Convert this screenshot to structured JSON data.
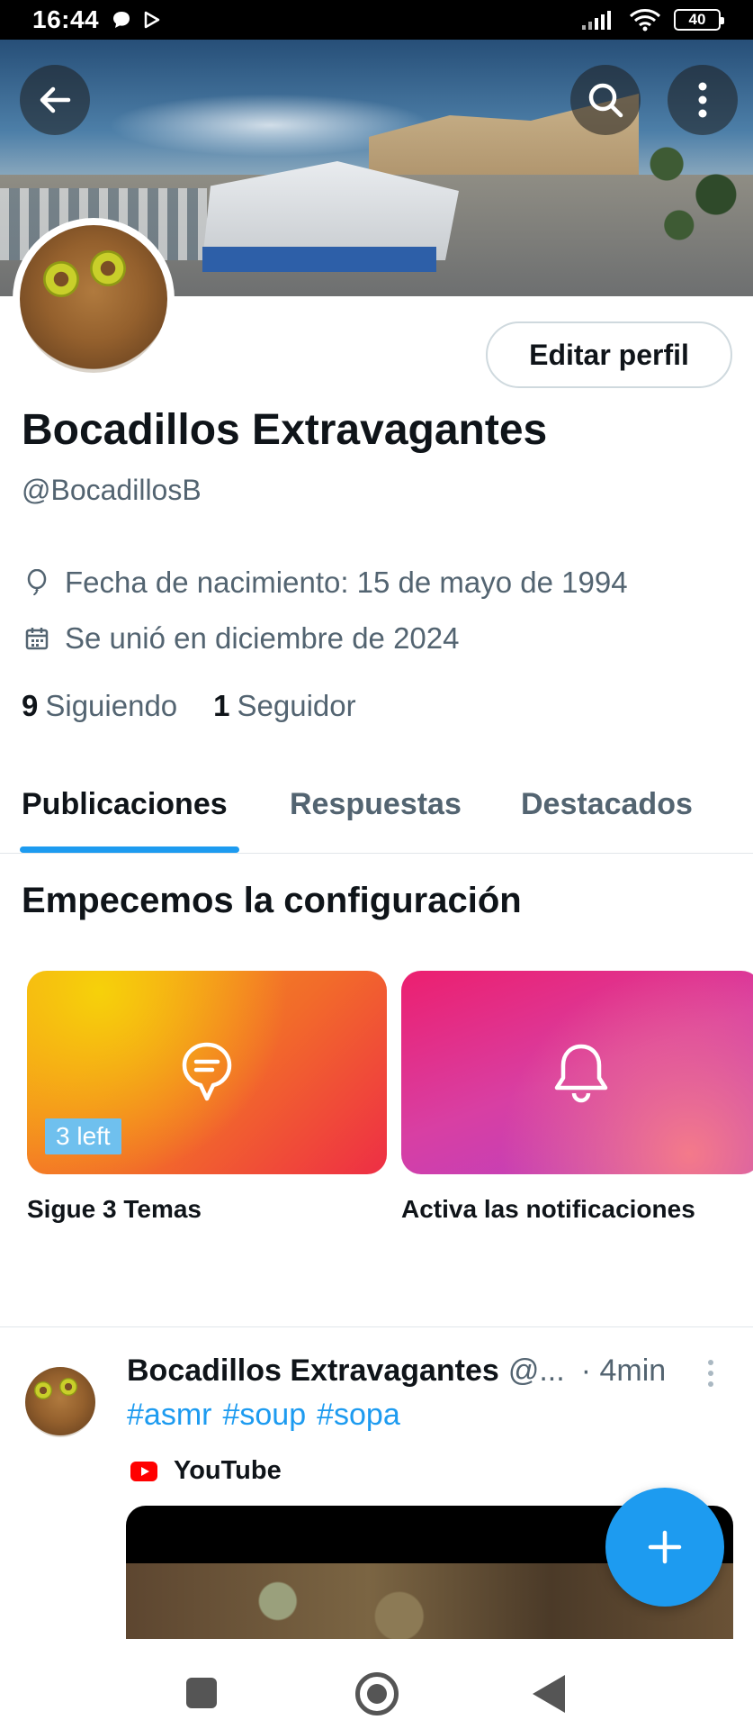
{
  "status_bar": {
    "time": "16:44",
    "battery": "40",
    "icons": [
      "chat-bubble-icon",
      "play-store-icon",
      "signal-icon",
      "wifi-icon",
      "battery-icon"
    ]
  },
  "header": {
    "buttons": [
      "back-arrow-icon",
      "search-icon",
      "more-vertical-icon"
    ]
  },
  "profile": {
    "edit_button": "Editar perfil",
    "name": "Bocadillos Extravagantes",
    "handle": "@BocadillosB",
    "birthdate": "Fecha de nacimiento: 15 de mayo de 1994",
    "joined": "Se unió en diciembre de 2024",
    "following_count": "9",
    "following_label": "Siguiendo",
    "followers_count": "1",
    "followers_label": "Seguidor"
  },
  "tabs": [
    {
      "label": "Publicaciones",
      "active": true
    },
    {
      "label": "Respuestas",
      "active": false
    },
    {
      "label": "Destacados",
      "active": false
    }
  ],
  "setup": {
    "title": "Empecemos la configuración",
    "cards": [
      {
        "label": "Sigue 3 Temas",
        "badge": "3 left",
        "icon": "topic-bubble-icon"
      },
      {
        "label": "Activa las notificaciones",
        "icon": "bell-icon"
      }
    ]
  },
  "post": {
    "author": "Bocadillos Extravagantes",
    "handle": "@...",
    "time": "· 4min",
    "hashtags": [
      "#asmr",
      "#soup",
      "#sopa"
    ],
    "source": "YouTube"
  },
  "fab": {
    "icon": "plus-icon"
  },
  "nav_bar": {
    "icons": [
      "recents-square-icon",
      "home-circle-icon",
      "back-triangle-icon"
    ]
  },
  "colors": {
    "accent": "#1d9bf0",
    "text_primary": "#0f1419",
    "text_secondary": "#536471"
  }
}
